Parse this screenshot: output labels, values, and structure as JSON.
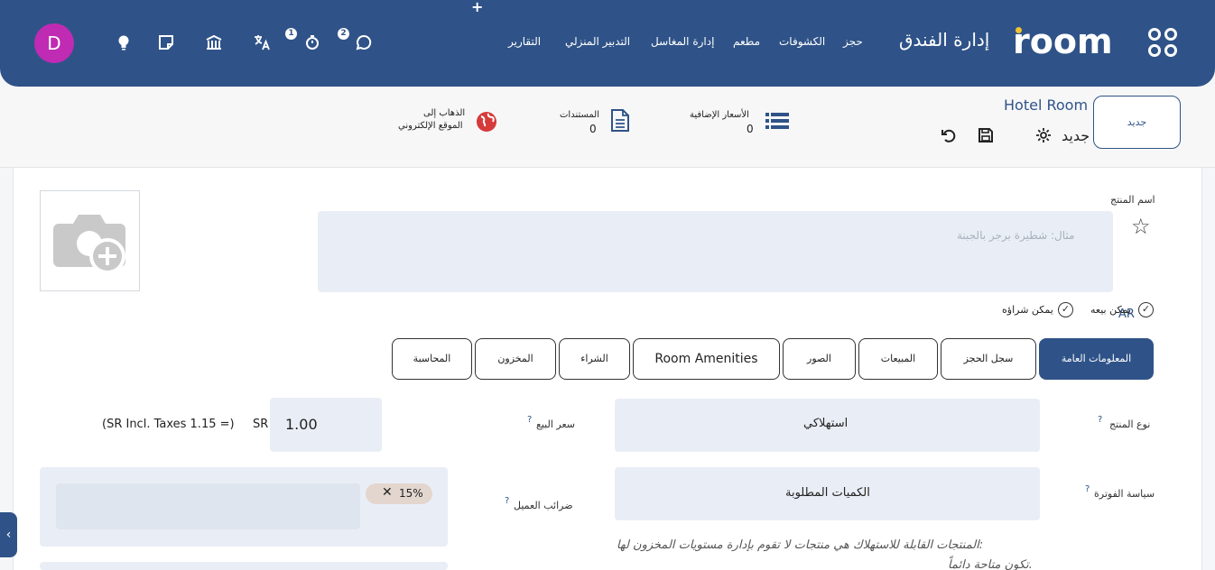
{
  "navbar": {
    "plus": "+",
    "brand": "room",
    "app_title": "إدارة الفندق",
    "menu": [
      "حجز",
      "الكشوفات",
      "مطعم",
      "إدارة المغاسل",
      "التدبير المنزلي",
      "التقارير"
    ],
    "badges": {
      "activity": "1",
      "messages": "2"
    },
    "avatar_letter": "D",
    "accent": "#2f5388",
    "avatar_color": "#c02bb3"
  },
  "control": {
    "new_button": "جديد",
    "breadcrumb": "Hotel Room",
    "record": "جديد",
    "smart_buttons": {
      "extra_prices": {
        "label": "الأسعار الإضافية",
        "value": "0"
      },
      "documents": {
        "label": "المستندات",
        "value": "0"
      },
      "website": {
        "label_line1": "الذهاب إلى",
        "label_line2": "الموقع الإلكتروني"
      }
    }
  },
  "form": {
    "product_name_label": "اسم المنتج",
    "product_name_placeholder": "مثال: شطيرة برجر بالجبنة",
    "lang": "AR",
    "can_be_sold": "يمكن بيعه",
    "can_be_purchased": "يمكن شراؤه",
    "tabs": [
      "المعلومات العامة",
      "سجل الحجز",
      "المبيعات",
      "الصور",
      "Room Amenities",
      "الشراء",
      "المخزون",
      "المحاسبة"
    ],
    "product_type_label": "نوع المنتج",
    "product_type_value": "استهلاكي",
    "invoice_policy_label": "سياسة الفوترة",
    "invoice_policy_value": "الكميات المطلوبة",
    "sale_price_label": "سعر البيع",
    "sale_price_value": "1.00",
    "currency": "SR",
    "incl_taxes": "(SR Incl. Taxes 1.15 =)",
    "customer_taxes_label": "ضرائب العميل",
    "tax_tag": "15%",
    "help": "?",
    "note_line1": "المنتجات القابلة للاستهلاك هي منتجات لا تقوم بإدارة مستويات المخزون لها:",
    "note_line2": "تكون متاحة دائماً."
  }
}
